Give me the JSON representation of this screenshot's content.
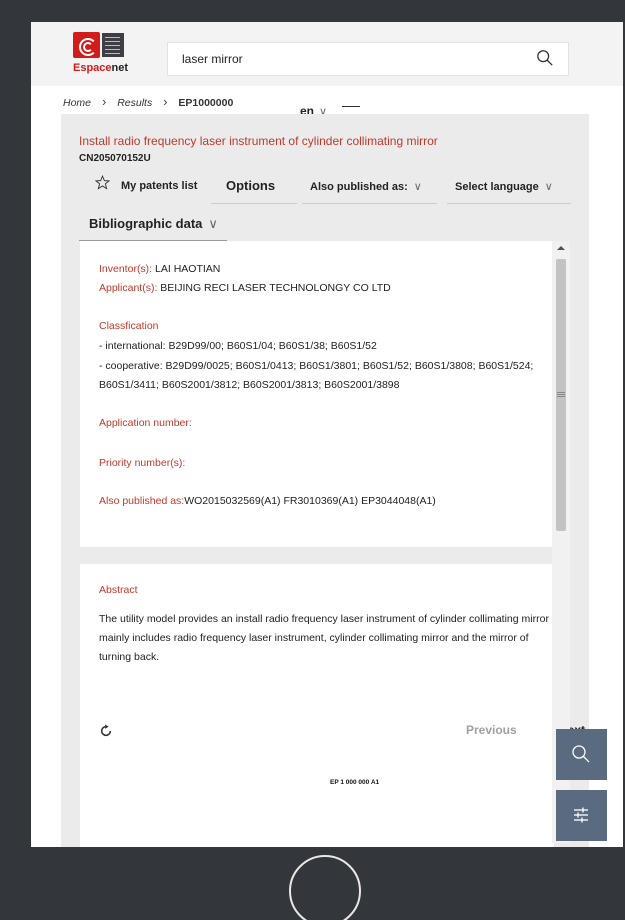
{
  "app": {
    "logo_text_red": "Espace",
    "logo_text_dark": "net"
  },
  "search": {
    "query": "laser mirror"
  },
  "breadcrumb": {
    "home": "Home",
    "results": "Results",
    "current": "EP1000000"
  },
  "header": {
    "language": "en"
  },
  "document": {
    "title": "Install radio frequency laser instrument of cylinder collimating mirror",
    "number": "CN205070152U"
  },
  "toolbar": {
    "my_patents": "My patents list",
    "options": "Options",
    "also_published": "Also published as:",
    "select_language": "Select language"
  },
  "tabs": {
    "biblio": "Bibliographic data"
  },
  "biblio": {
    "inventor_label": "Inventor(s):",
    "inventor_value": "LAI HAOTIAN",
    "applicant_label": "Applicant(s):",
    "applicant_value": "BEIJING RECI LASER TECHNOLONGY CO LTD",
    "classification_label": "Classfication",
    "class_international": "- international: B29D99/00; B60S1/04; B60S1/38; B60S1/52",
    "class_cooperative": "- cooperative: B29D99/0025; B60S1/0413; B60S1/3801; B60S1/52; B60S1/3808; B60S1/524; B60S1/3411; B60S2001/3812; B60S2001/3813; B60S2001/3898",
    "application_number_label": "Application number:",
    "priority_number_label": "Priority number(s):",
    "also_published_label": "Also published as:",
    "also_published_value": "WO2015032569(A1) FR3010369(A1) EP3044048(A1)"
  },
  "abstract": {
    "heading": "Abstract",
    "text": "The utility model provides an install radio frequency laser instrument of cylinder collimating mirror mainly includes radio frequency laser instrument, cylinder collimating mirror and the mirror of turning back."
  },
  "viewer": {
    "previous": "Previous",
    "next": "Next",
    "doc_label": "EP 1 000 000 A1"
  },
  "colors": {
    "accent_red": "#c0392b",
    "fab": "#5a6b7f",
    "background": "#ebebeb"
  },
  "icons": [
    "search-icon",
    "chevron-right-icon",
    "chevron-down-icon",
    "hamburger-icon",
    "star-icon",
    "refresh-icon",
    "filter-icon",
    "home-button-icon"
  ]
}
